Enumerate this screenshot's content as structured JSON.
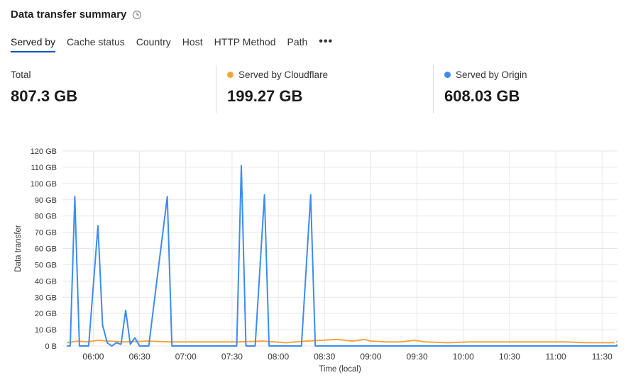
{
  "header": {
    "title": "Data transfer summary",
    "info_icon": "clock-icon"
  },
  "tabs": [
    {
      "label": "Served by",
      "active": true
    },
    {
      "label": "Cache status"
    },
    {
      "label": "Country"
    },
    {
      "label": "Host"
    },
    {
      "label": "HTTP Method"
    },
    {
      "label": "Path"
    }
  ],
  "more_label": "•••",
  "stats": {
    "total": {
      "label": "Total",
      "value": "807.3 GB"
    },
    "cloudflare": {
      "label": "Served by Cloudflare",
      "value": "199.27 GB",
      "color": "#f6a53d"
    },
    "origin": {
      "label": "Served by Origin",
      "value": "608.03 GB",
      "color": "#3c8cf2"
    }
  },
  "chart_data": {
    "type": "line",
    "xlabel": "Time (local)",
    "ylabel": "Data transfer",
    "ylim": [
      0,
      120
    ],
    "xlim": [
      "05:40",
      "11:40"
    ],
    "y_ticks": [
      "0 B",
      "10 GB",
      "20 GB",
      "30 GB",
      "40 GB",
      "50 GB",
      "60 GB",
      "70 GB",
      "80 GB",
      "90 GB",
      "100 GB",
      "110 GB",
      "120 GB"
    ],
    "x_ticks": [
      "06:00",
      "06:30",
      "07:00",
      "07:30",
      "08:00",
      "08:30",
      "09:00",
      "09:30",
      "10:00",
      "10:30",
      "11:00",
      "11:30"
    ],
    "grid": true,
    "series": [
      {
        "name": "Served by Origin",
        "color": "#3c8cf2",
        "points": [
          [
            "05:43",
            0
          ],
          [
            "05:45",
            0
          ],
          [
            "05:48",
            92
          ],
          [
            "05:51",
            0
          ],
          [
            "05:57",
            0
          ],
          [
            "06:03",
            74
          ],
          [
            "06:06",
            13
          ],
          [
            "06:09",
            2
          ],
          [
            "06:12",
            0
          ],
          [
            "06:15",
            2
          ],
          [
            "06:18",
            1
          ],
          [
            "06:21",
            22
          ],
          [
            "06:24",
            1
          ],
          [
            "06:27",
            5
          ],
          [
            "06:30",
            0
          ],
          [
            "06:36",
            0
          ],
          [
            "06:48",
            92
          ],
          [
            "06:51",
            0
          ],
          [
            "07:30",
            0
          ],
          [
            "07:33",
            0
          ],
          [
            "07:36",
            111
          ],
          [
            "07:39",
            0
          ],
          [
            "07:45",
            0
          ],
          [
            "07:51",
            93
          ],
          [
            "07:54",
            0
          ],
          [
            "08:15",
            0
          ],
          [
            "08:21",
            93
          ],
          [
            "08:24",
            0
          ],
          [
            "11:40",
            0
          ]
        ]
      },
      {
        "name": "Served by Cloudflare",
        "color": "#f6a53d",
        "points": [
          [
            "05:43",
            2
          ],
          [
            "05:50",
            3
          ],
          [
            "05:56",
            2.5
          ],
          [
            "06:03",
            3.5
          ],
          [
            "06:10",
            3
          ],
          [
            "06:20",
            2.5
          ],
          [
            "06:35",
            3
          ],
          [
            "06:50",
            2.5
          ],
          [
            "07:05",
            2.5
          ],
          [
            "07:20",
            2.5
          ],
          [
            "07:35",
            2.5
          ],
          [
            "07:50",
            3
          ],
          [
            "08:05",
            2
          ],
          [
            "08:18",
            3
          ],
          [
            "08:28",
            3.5
          ],
          [
            "08:38",
            4
          ],
          [
            "08:48",
            3
          ],
          [
            "08:56",
            4
          ],
          [
            "09:00",
            3
          ],
          [
            "09:10",
            2.5
          ],
          [
            "09:20",
            2.5
          ],
          [
            "09:28",
            3.5
          ],
          [
            "09:35",
            2.5
          ],
          [
            "09:50",
            2
          ],
          [
            "10:05",
            2.5
          ],
          [
            "10:20",
            2.5
          ],
          [
            "10:35",
            2.5
          ],
          [
            "10:50",
            2.5
          ],
          [
            "11:05",
            2.5
          ],
          [
            "11:20",
            2
          ],
          [
            "11:38",
            2
          ]
        ]
      }
    ]
  }
}
